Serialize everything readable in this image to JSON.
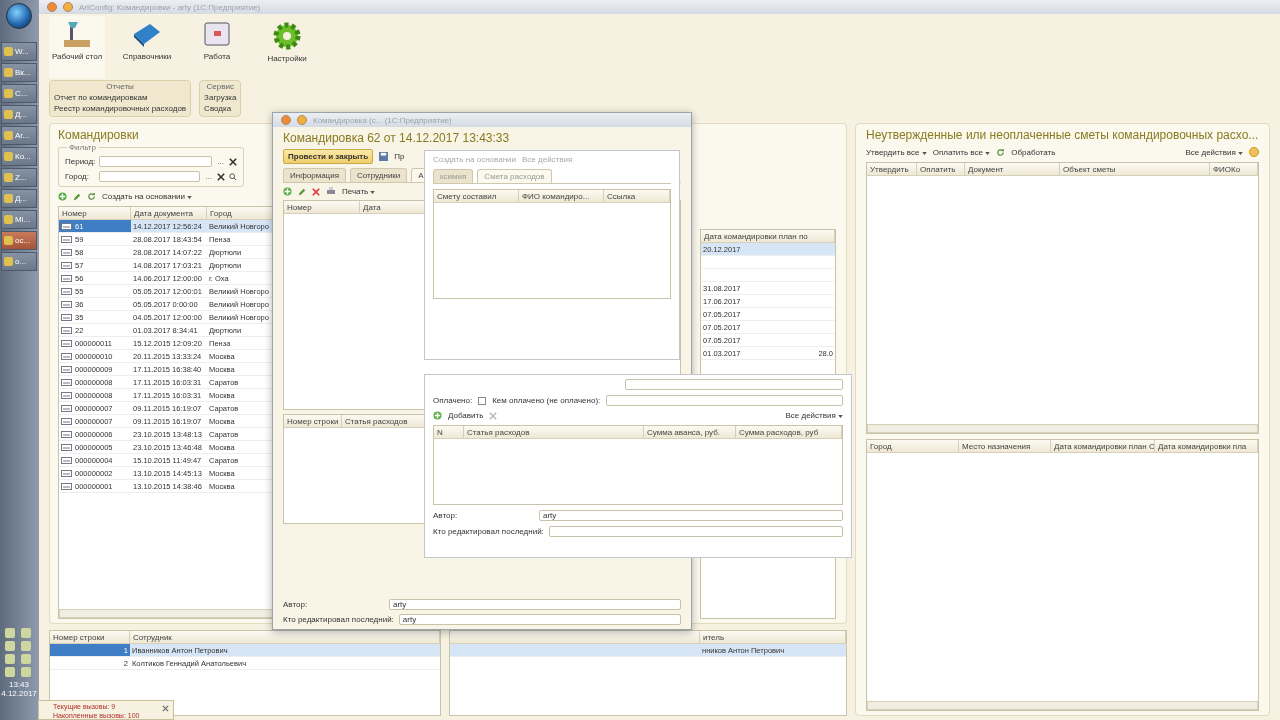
{
  "taskbar": {
    "items": [
      {
        "label": "W...",
        "selected": false
      },
      {
        "label": "Вк...",
        "selected": false
      },
      {
        "label": "С...",
        "selected": false
      },
      {
        "label": "Д...",
        "selected": false
      },
      {
        "label": "Ar...",
        "selected": false
      },
      {
        "label": "Ко...",
        "selected": false
      },
      {
        "label": "Z...",
        "selected": false
      },
      {
        "label": "Д...",
        "selected": false
      },
      {
        "label": "Mi...",
        "selected": false
      },
      {
        "label": "ос...",
        "selected": true
      },
      {
        "label": "о...",
        "selected": false
      }
    ],
    "time": "13:43",
    "date": "4.12.2017"
  },
  "window": {
    "title": "ArtConfig: Командировки - arty  (1С:Предприятие)"
  },
  "sections": [
    {
      "label": "Рабочий стол",
      "kind": "desk",
      "selected": true
    },
    {
      "label": "Справочники",
      "kind": "book",
      "selected": false
    },
    {
      "label": "Работа",
      "kind": "work",
      "selected": false
    },
    {
      "label": "Настройки",
      "kind": "gear",
      "selected": false
    }
  ],
  "command_groups": [
    {
      "title": "Отчеты",
      "items": [
        "Отчет по командировкам",
        "Реестр командировочных расходов"
      ]
    },
    {
      "title": "Сервис",
      "items": [
        "Загрузка",
        "Сводка"
      ]
    }
  ],
  "trips_panel": {
    "title": "Командировки",
    "filter": {
      "title": "Фильтр",
      "fields": [
        {
          "label": "Период:",
          "select_button": "...",
          "search": false
        },
        {
          "label": "Город:",
          "select_button": "...",
          "search": true
        }
      ]
    },
    "create_based_on": "Создать на основании",
    "columns": [
      "Номер",
      "Дата документа",
      "Город"
    ],
    "rows": [
      {
        "number": "61",
        "date": "14.12.2017 12:56:24",
        "city": "Великий Новгоро",
        "selected": true
      },
      {
        "number": "59",
        "date": "28.08.2017 18:43:54",
        "city": "Пенза",
        "selected": false
      },
      {
        "number": "58",
        "date": "28.08.2017 14:07:22",
        "city": "Дюртюли",
        "selected": false
      },
      {
        "number": "57",
        "date": "14.08.2017 17:03:21",
        "city": "Дюртюли",
        "selected": false
      },
      {
        "number": "56",
        "date": "14.06.2017 12:00:00",
        "city": "г. Оха",
        "selected": false
      },
      {
        "number": "55",
        "date": "05.05.2017 12:00:01",
        "city": "Великий Новгоро",
        "selected": false
      },
      {
        "number": "36",
        "date": "05.05.2017 0:00:00",
        "city": "Великий Новгоро",
        "selected": false
      },
      {
        "number": "35",
        "date": "04.05.2017 12:00:00",
        "city": "Великий Новгоро",
        "selected": false
      },
      {
        "number": "22",
        "date": "01.03.2017 8:34:41",
        "city": "Дюртюли",
        "selected": false
      },
      {
        "number": "000000011",
        "date": "15.12.2015 12:09:20",
        "city": "Пенза",
        "selected": false
      },
      {
        "number": "000000010",
        "date": "20.11.2015 13:33:24",
        "city": "Москва",
        "selected": false
      },
      {
        "number": "000000009",
        "date": "17.11.2015 16:38:40",
        "city": "Москва",
        "selected": false
      },
      {
        "number": "000000008",
        "date": "17.11.2015 16:03:31",
        "city": "Саратов",
        "selected": false
      },
      {
        "number": "000000008",
        "date": "17.11.2015 16:03:31",
        "city": "Москва",
        "selected": false
      },
      {
        "number": "000000007",
        "date": "09.11.2015 16:19:07",
        "city": "Саратов",
        "selected": false
      },
      {
        "number": "000000007",
        "date": "09.11.2015 16:19:07",
        "city": "Москва",
        "selected": false
      },
      {
        "number": "000000006",
        "date": "23.10.2015 13:48:13",
        "city": "Саратов",
        "selected": false
      },
      {
        "number": "000000005",
        "date": "23.10.2015 13:46:48",
        "city": "Москва",
        "selected": false
      },
      {
        "number": "000000004",
        "date": "15.10.2015 11:49:47",
        "city": "Саратов",
        "selected": false
      },
      {
        "number": "000000002",
        "date": "13.10.2015 14:45:13",
        "city": "Москва",
        "selected": false
      },
      {
        "number": "000000001",
        "date": "13.10.2015 14:38:46",
        "city": "Москва",
        "selected": false
      }
    ]
  },
  "employees_table": {
    "columns": [
      "Номер строки",
      "Сотрудник"
    ],
    "rows": [
      {
        "n": "1",
        "name": "Иванников Антон Петрович",
        "selected": true
      },
      {
        "n": "2",
        "name": "Колтиков Геннадий Анатольевич",
        "selected": false
      }
    ]
  },
  "middle_panel": {
    "column": "Дата командировки план по",
    "rows": [
      {
        "date": "20.12.2017",
        "column_2": "",
        "selected": true
      },
      {
        "date": "",
        "column_2": "",
        "selected": false
      },
      {
        "date": "",
        "column_2": "",
        "selected": false
      },
      {
        "date": "31.08.2017",
        "column_2": "",
        "selected": false
      },
      {
        "date": "17.06.2017",
        "column_2": "",
        "selected": false
      },
      {
        "date": "07.05.2017",
        "column_2": "",
        "selected": false
      },
      {
        "date": "07.05.2017",
        "column_2": "",
        "selected": false
      },
      {
        "date": "07.05.2017",
        "column_2": "",
        "selected": false
      },
      {
        "date": "01.03.2017",
        "column_2": "28.0",
        "selected": false
      }
    ],
    "bottom_column": "итель",
    "bottom_rows": [
      {
        "text": "нников Антон Петрович",
        "selected": true
      }
    ]
  },
  "estimates_panel": {
    "title": "Неутвержденные или неоплаченные сметы командировочных расхо...",
    "toolbar": [
      "Утвердить все",
      "Оплатить все"
    ],
    "process": "Обработать",
    "all_actions": "Все действия",
    "columns": [
      "Утвердить",
      "Оплатить",
      "Документ",
      "Объект сметы",
      "ФИОКо"
    ],
    "bottom_columns": [
      "Город",
      "Место назначения",
      "Дата командировки план С",
      "Дата командировки пла"
    ]
  },
  "trip_dialog": {
    "title": "Командировка (с...  (1С:Предприятие)",
    "heading": "Командировка 62 от 14.12.2017 13:43:33",
    "post_close": "Провести и закрыть",
    "more": "Пр",
    "tabs": [
      {
        "label": "Информация",
        "selected": false
      },
      {
        "label": "Сотрудники",
        "selected": false
      },
      {
        "label": "А",
        "selected": true
      }
    ],
    "print": "Печать",
    "columns": [
      "Номер",
      "Дата"
    ],
    "bottom_columns": [
      "Номер строки",
      "Статья расходов"
    ],
    "fields": [
      {
        "label": "Автор:",
        "value": "arty"
      },
      {
        "label": "Кто редактировал последний:",
        "value": "arty"
      }
    ]
  },
  "estimate_dialog": {
    "toolbar": [
      "Создать на основании",
      "Все действия"
    ],
    "tabs": [
      {
        "label": "ксимия",
        "selected": false
      },
      {
        "label": "Смета расходов",
        "selected": true
      }
    ],
    "columns": [
      "Смету составил",
      "ФИО командиро...",
      "Ссылка"
    ],
    "paid_label": "Оплачено:",
    "paid": false,
    "paid_by_label": "Кем оплачено (не оплачено):",
    "add": "Добавить",
    "all_actions": "Все действия",
    "expense_columns": [
      "N",
      "Статья расходов",
      "Сумма аванса, руб.",
      "Сумма расходов, руб"
    ],
    "fields": [
      {
        "label": "Автор:",
        "value": "arty"
      },
      {
        "label": "Кто редактировал последний:"
      }
    ]
  },
  "notification": {
    "lines": [
      "Текущие вызовы: 9",
      "Накопленные вызовы: 100"
    ]
  }
}
